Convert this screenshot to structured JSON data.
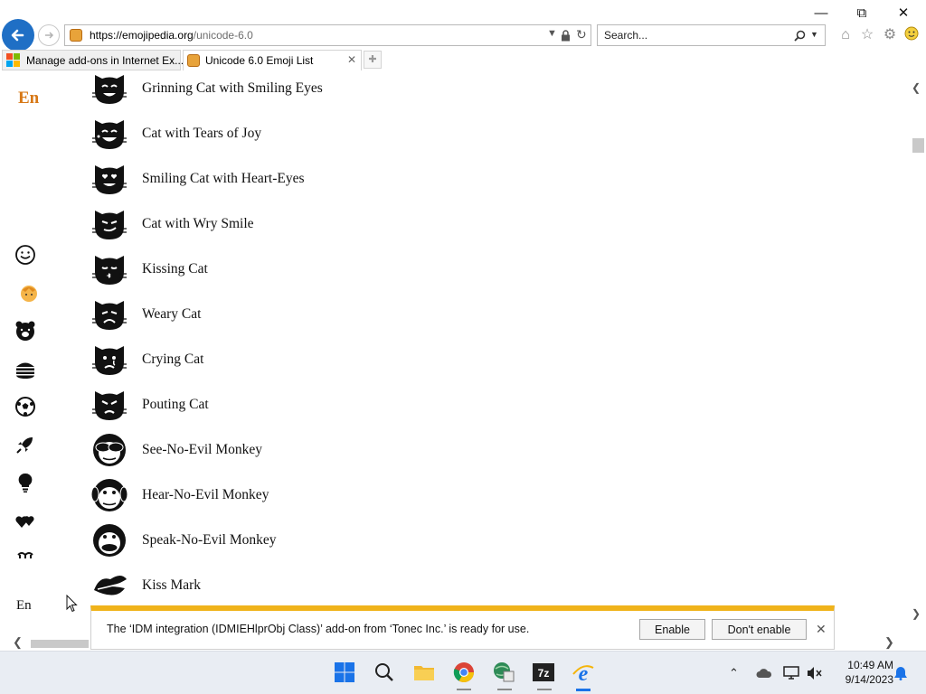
{
  "browser": {
    "address_url_main": "https://emojipedia.org",
    "address_url_path": "/unicode-6.0",
    "search_placeholder": "Search...",
    "tabs": [
      {
        "label": "Manage add-ons in Internet Ex..."
      },
      {
        "label": "Unicode 6.0 Emoji List"
      }
    ]
  },
  "sidebar": {
    "logo": "En",
    "footer": "En",
    "icons": [
      "smiley-face-icon",
      "person-icon",
      "bear-face-icon",
      "burger-icon",
      "soccer-ball-icon",
      "rocket-icon",
      "lightbulb-icon",
      "hearts-icon",
      "flags-icon"
    ]
  },
  "emoji_list": [
    {
      "name": "Grinning Cat with Smiling Eyes",
      "icon": "grinning-cat-icon"
    },
    {
      "name": "Cat with Tears of Joy",
      "icon": "cat-tears-joy-icon"
    },
    {
      "name": "Smiling Cat with Heart-Eyes",
      "icon": "cat-heart-eyes-icon"
    },
    {
      "name": "Cat with Wry Smile",
      "icon": "cat-wry-smile-icon"
    },
    {
      "name": "Kissing Cat",
      "icon": "kissing-cat-icon"
    },
    {
      "name": "Weary Cat",
      "icon": "weary-cat-icon"
    },
    {
      "name": "Crying Cat",
      "icon": "crying-cat-icon"
    },
    {
      "name": "Pouting Cat",
      "icon": "pouting-cat-icon"
    },
    {
      "name": "See-No-Evil Monkey",
      "icon": "see-no-evil-monkey-icon"
    },
    {
      "name": "Hear-No-Evil Monkey",
      "icon": "hear-no-evil-monkey-icon"
    },
    {
      "name": "Speak-No-Evil Monkey",
      "icon": "speak-no-evil-monkey-icon"
    },
    {
      "name": "Kiss Mark",
      "icon": "kiss-mark-icon"
    }
  ],
  "notification": {
    "message": "The ‘IDM integration (IDMIEHlprObj Class)’ add-on from ‘Tonec Inc.’ is ready for use.",
    "enable_label": "Enable",
    "dont_enable_label": "Don't enable"
  },
  "taskbar": {
    "time": "10:49 AM",
    "date": "9/14/2023"
  },
  "colors": {
    "accent_blue": "#1f6fc5",
    "logo_orange": "#d77816",
    "notify_yellow": "#f0b31a"
  }
}
